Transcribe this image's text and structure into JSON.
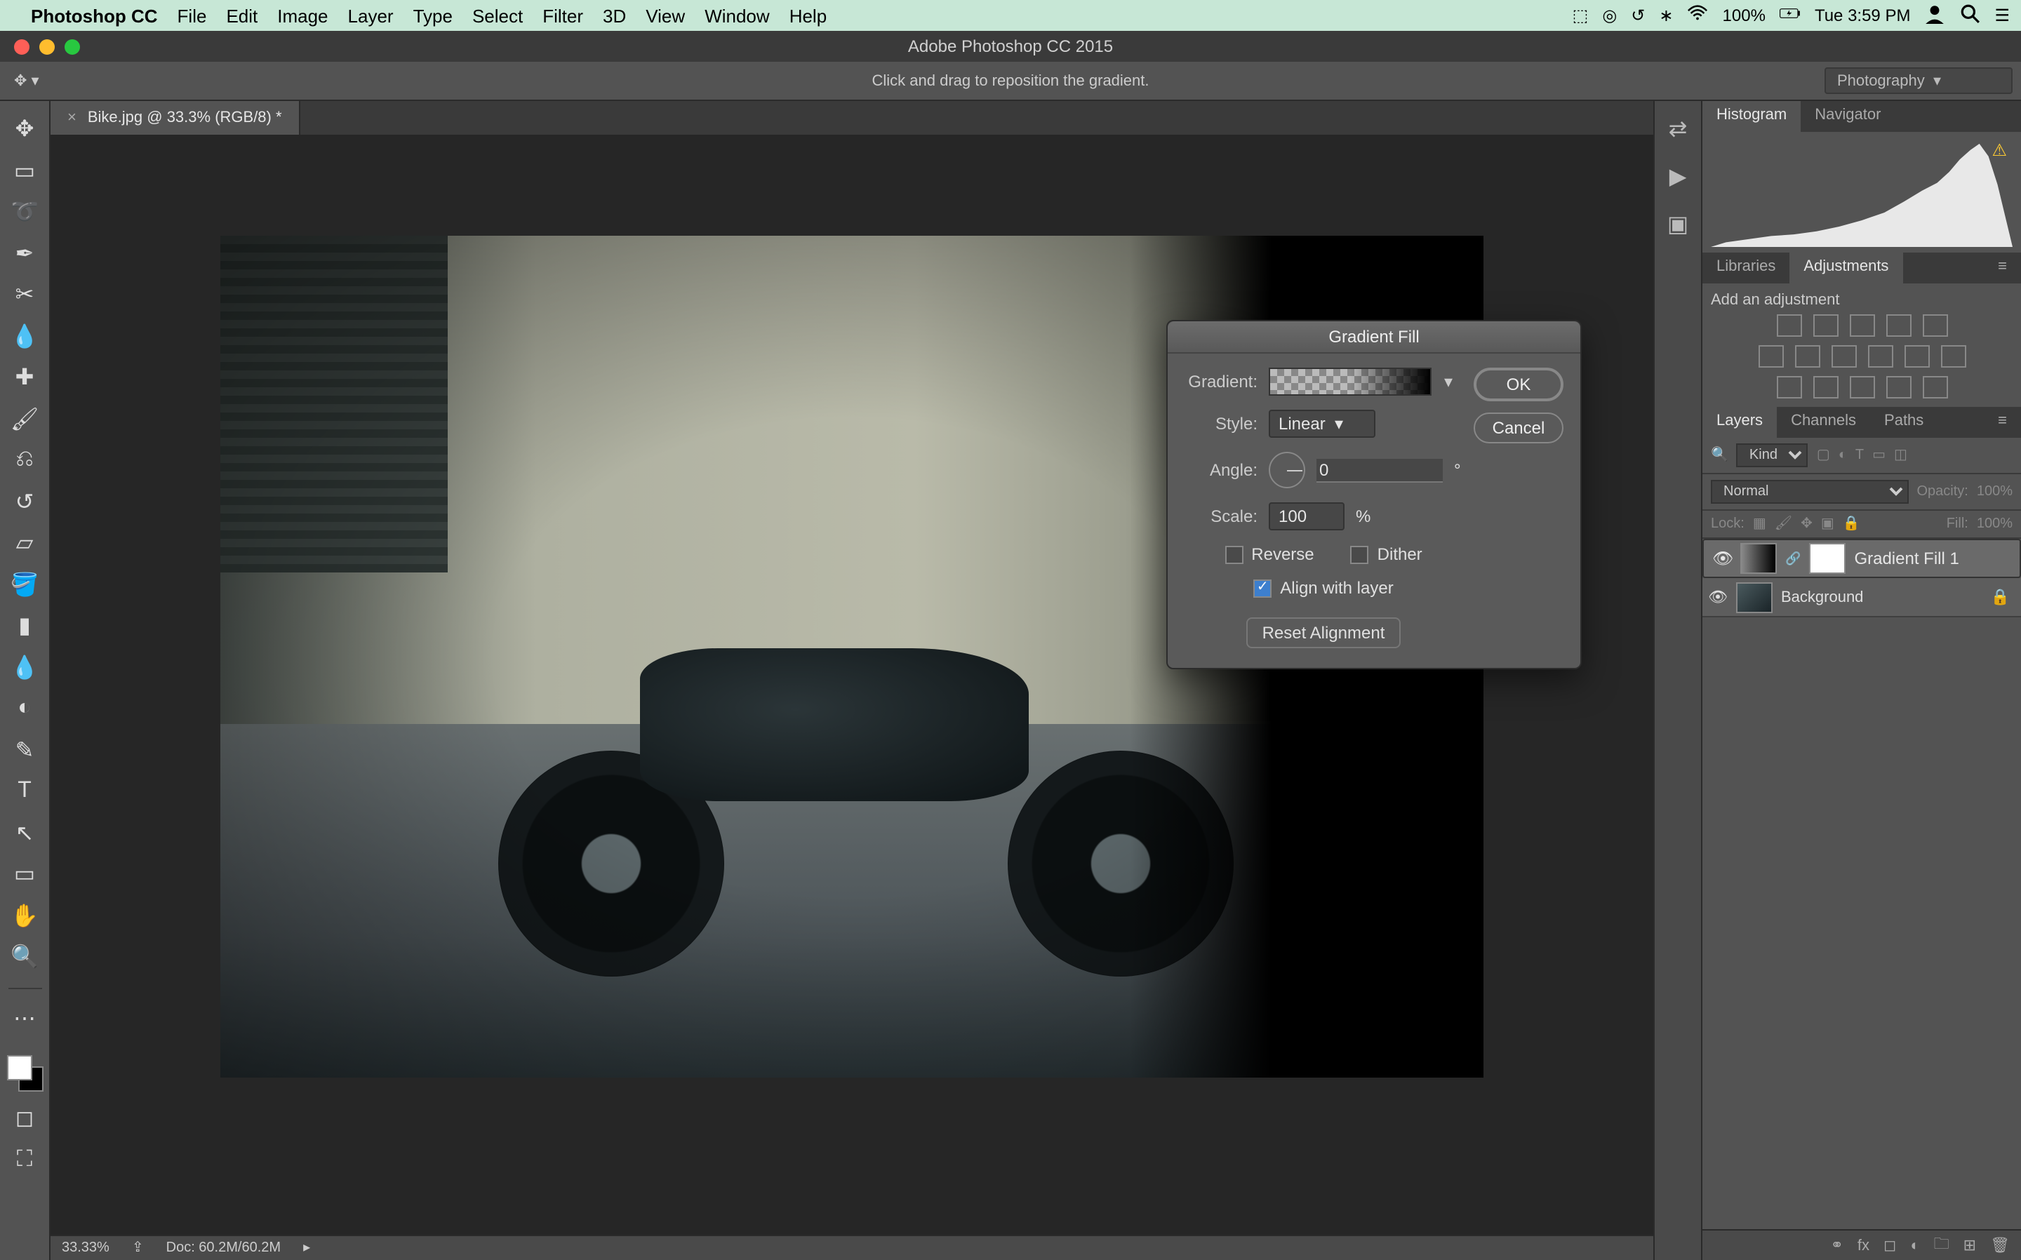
{
  "menubar": {
    "apple": "",
    "app": "Photoshop CC",
    "items": [
      "File",
      "Edit",
      "Image",
      "Layer",
      "Type",
      "Select",
      "Filter",
      "3D",
      "View",
      "Window",
      "Help"
    ],
    "battery": "100%",
    "clock": "Tue 3:59 PM"
  },
  "window": {
    "title": "Adobe Photoshop CC 2015"
  },
  "optionsbar": {
    "hint": "Click and drag to reposition the gradient.",
    "workspace": "Photography"
  },
  "document": {
    "tab": "Bike.jpg @ 33.3% (RGB/8) *",
    "zoom": "33.33%",
    "docsize": "Doc: 60.2M/60.2M"
  },
  "dialog": {
    "title": "Gradient Fill",
    "ok": "OK",
    "cancel": "Cancel",
    "gradient_label": "Gradient:",
    "style_label": "Style:",
    "style_value": "Linear",
    "angle_label": "Angle:",
    "angle_value": "0",
    "angle_unit": "°",
    "scale_label": "Scale:",
    "scale_value": "100",
    "scale_unit": "%",
    "reverse": "Reverse",
    "dither": "Dither",
    "align": "Align with layer",
    "align_checked": true,
    "reset": "Reset Alignment"
  },
  "panels": {
    "histogram_tab": "Histogram",
    "navigator_tab": "Navigator",
    "libraries_tab": "Libraries",
    "adjustments_tab": "Adjustments",
    "adjustments_title": "Add an adjustment",
    "layers_tab": "Layers",
    "channels_tab": "Channels",
    "paths_tab": "Paths",
    "kind_placeholder": "Kind",
    "blend_mode": "Normal",
    "opacity_label": "Opacity:",
    "opacity_value": "100%",
    "lock_label": "Lock:",
    "fill_label": "Fill:",
    "fill_value": "100%",
    "layers": [
      {
        "name": "Gradient Fill 1",
        "locked": false
      },
      {
        "name": "Background",
        "locked": true
      }
    ]
  }
}
